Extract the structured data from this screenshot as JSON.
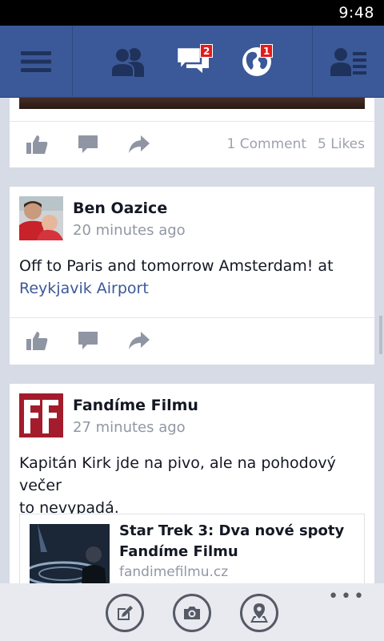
{
  "status_bar": {
    "time": "9:48"
  },
  "top_nav": {
    "messages_badge": "2",
    "notifications_badge": "1"
  },
  "posts": [
    {
      "counts": {
        "comments": "1 Comment",
        "likes": "5 Likes"
      }
    },
    {
      "author": "Ben Oazice",
      "time": "20 minutes ago",
      "text": "Off to Paris and tomorrow Amsterdam! at",
      "place": "Reykjavik Airport"
    },
    {
      "author": "Fandíme Filmu",
      "time": "27 minutes ago",
      "text_line1": "Kapitán Kirk jde na pivo, ale na pohodový večer",
      "text_line2": "to nevypadá.",
      "link_preview": {
        "title_line1": "Star Trek 3: Dva nové spoty",
        "title_line2": "Fandíme Filmu",
        "domain": "fandimefilmu.cz"
      }
    }
  ],
  "app_bar": {
    "more": "•••"
  },
  "colors": {
    "brand": "#3b5998",
    "badge": "#e41b1b",
    "background": "#d7dbe6"
  }
}
